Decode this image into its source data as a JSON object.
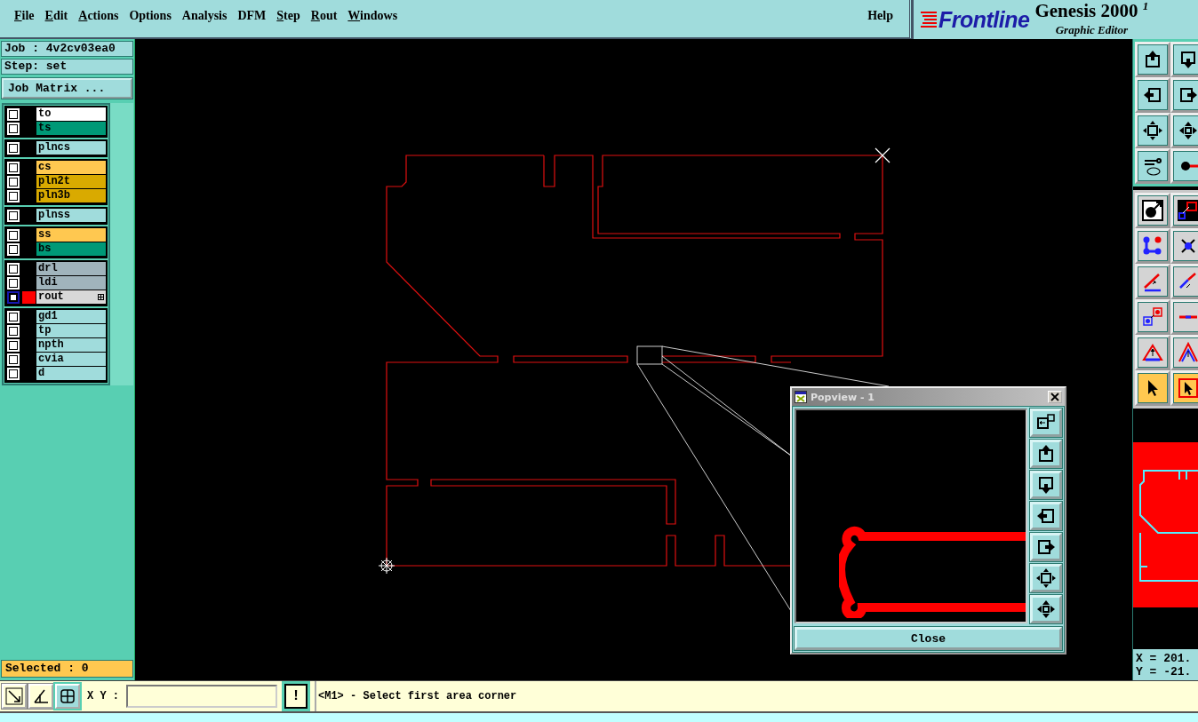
{
  "menu": {
    "items": [
      {
        "label": "File",
        "underline_first": true
      },
      {
        "label": "Edit",
        "underline_first": true
      },
      {
        "label": "Actions",
        "underline_first": true
      },
      {
        "label": "Options",
        "underline_first": false
      },
      {
        "label": "Analysis",
        "underline_first": false
      },
      {
        "label": "DFM",
        "underline_first": false
      },
      {
        "label": "Step",
        "underline_first": true
      },
      {
        "label": "Rout",
        "underline_first": true
      },
      {
        "label": "Windows",
        "underline_first": true
      }
    ],
    "help": "Help"
  },
  "brand": {
    "logo": "Frontline",
    "product": "Genesis 2000 $^{1}$",
    "subtitle": "Graphic Editor"
  },
  "job": {
    "job": "Job : 4v2cv03ea0",
    "step": "Step: set",
    "matrix_button": "Job Matrix ..."
  },
  "layer_groups": [
    {
      "layers": [
        {
          "name": "to",
          "color": "#ffffff",
          "displayed": false,
          "affected": false
        },
        {
          "name": "ts",
          "color": "#009977",
          "displayed": false,
          "affected": false
        }
      ]
    },
    {
      "layers": [
        {
          "name": "plncs",
          "color": "#a0dcdc",
          "displayed": false,
          "affected": false
        }
      ]
    },
    {
      "layers": [
        {
          "name": "cs",
          "color": "#ffc850",
          "displayed": false,
          "affected": false
        },
        {
          "name": "pln2t",
          "color": "#d9aa00",
          "displayed": false,
          "affected": false
        },
        {
          "name": "pln3b",
          "color": "#d9aa00",
          "displayed": false,
          "affected": false
        }
      ]
    },
    {
      "layers": [
        {
          "name": "plnss",
          "color": "#a0dcdc",
          "displayed": false,
          "affected": false
        }
      ]
    },
    {
      "layers": [
        {
          "name": "ss",
          "color": "#ffc850",
          "displayed": false,
          "affected": false
        },
        {
          "name": "bs",
          "color": "#009977",
          "displayed": false,
          "affected": false
        }
      ]
    },
    {
      "layers": [
        {
          "name": "drl",
          "color": "#a0b4bc",
          "displayed": false,
          "affected": false
        },
        {
          "name": "ldi",
          "color": "#a0b4bc",
          "displayed": false,
          "affected": false
        },
        {
          "name": "rout",
          "color": "#d8d8d8",
          "displayed": true,
          "affected": true
        }
      ]
    },
    {
      "layers": [
        {
          "name": "gd1",
          "color": "#a0dcdc",
          "displayed": false,
          "affected": false
        },
        {
          "name": "tp",
          "color": "#a0dcdc",
          "displayed": false,
          "affected": false
        },
        {
          "name": "npth",
          "color": "#a0dcdc",
          "displayed": false,
          "affected": false
        },
        {
          "name": "cvia",
          "color": "#a0dcdc",
          "displayed": false,
          "affected": false
        },
        {
          "name": "d",
          "color": "#a0dcdc",
          "displayed": false,
          "affected": false
        }
      ]
    }
  ],
  "selected_count": "Selected : 0",
  "popview": {
    "title": "Popview - 1",
    "close_button": "Close"
  },
  "tools": [
    {
      "kind": "up",
      "active": false
    },
    {
      "kind": "down",
      "active": false
    },
    {
      "kind": "left",
      "active": false
    },
    {
      "kind": "right",
      "active": false
    },
    {
      "kind": "fit",
      "active": false
    },
    {
      "kind": "pan",
      "active": false
    },
    {
      "kind": "wrench",
      "active": false
    },
    {
      "kind": "snap",
      "active": false
    },
    {
      "kind": "feature",
      "active": false
    },
    {
      "kind": "area",
      "active": false
    },
    {
      "kind": "nodes",
      "active": false
    },
    {
      "kind": "cross",
      "active": false
    },
    {
      "kind": "line",
      "active": false
    },
    {
      "kind": "line2",
      "active": false
    },
    {
      "kind": "padmove",
      "active": false
    },
    {
      "kind": "dash",
      "active": false
    },
    {
      "kind": "tri",
      "active": false
    },
    {
      "kind": "tri2",
      "active": false
    },
    {
      "kind": "pointer",
      "active": true
    },
    {
      "kind": "pointerbox",
      "active": true
    }
  ],
  "coordinates": {
    "x": "X = 201.",
    "y": "Y = -21."
  },
  "command_bar": {
    "xy_label": "X Y :",
    "alert_button": "!",
    "message": "<M1> - Select first area corner"
  }
}
